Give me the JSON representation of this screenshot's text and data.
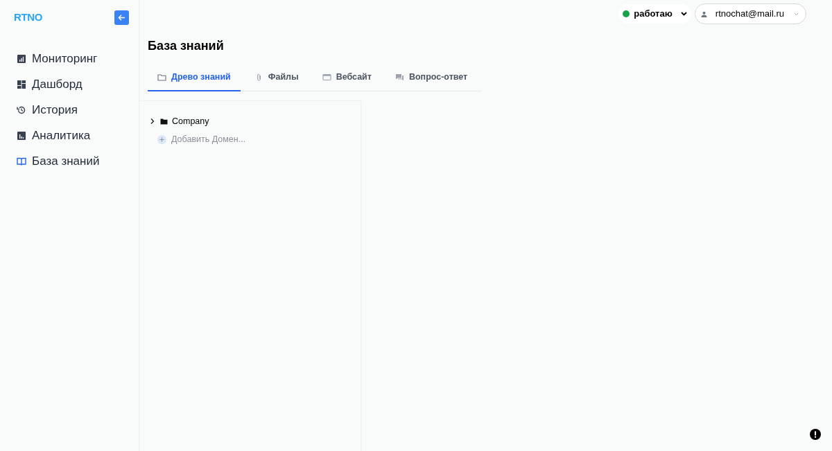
{
  "logo": "RTNO",
  "nav": [
    {
      "label": "Мониторинг",
      "kind": "monitoring",
      "selected": false
    },
    {
      "label": "Дашборд",
      "kind": "dashboard",
      "selected": false
    },
    {
      "label": "История",
      "kind": "history",
      "selected": false
    },
    {
      "label": "Аналитика",
      "kind": "analytics",
      "selected": false
    },
    {
      "label": "База знаний",
      "kind": "knowledge",
      "selected": true
    }
  ],
  "status": {
    "label": "работаю",
    "color": "#16a34a"
  },
  "user": {
    "email": "rtnochat@mail.ru"
  },
  "page_title": "База знаний",
  "tabs": [
    {
      "label": "Древо знаний",
      "kind": "folder",
      "selected": true
    },
    {
      "label": "Файлы",
      "kind": "clip",
      "selected": false
    },
    {
      "label": "Вебсайт",
      "kind": "window",
      "selected": false
    },
    {
      "label": "Вопрос-ответ",
      "kind": "chat",
      "selected": false
    }
  ],
  "tree": [
    {
      "label": "Company",
      "expanded": false
    }
  ],
  "add_domain": "Добавить Домен..."
}
